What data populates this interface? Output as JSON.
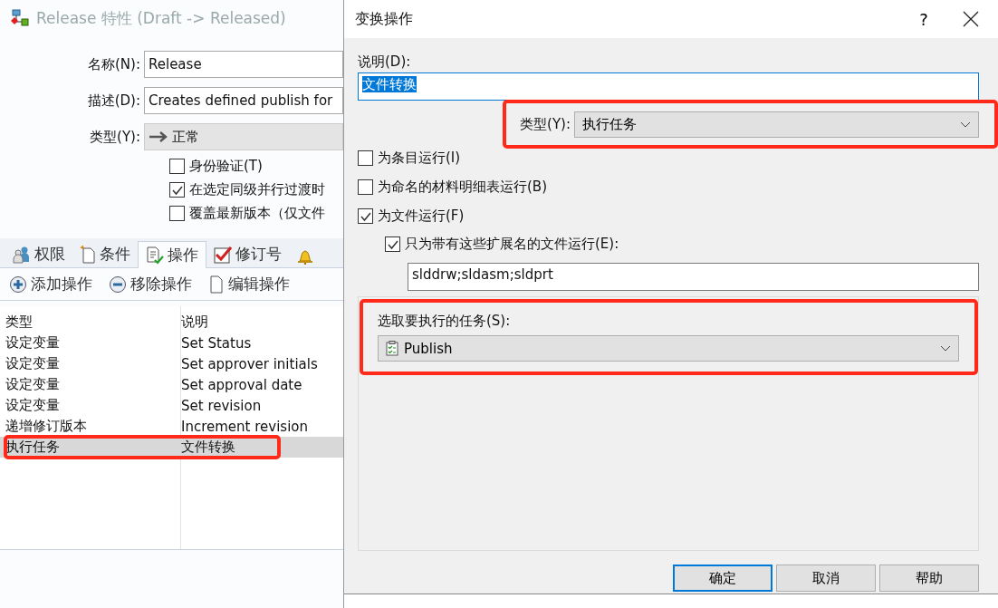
{
  "window": {
    "title": "Release 特性 (Draft -> Released)"
  },
  "form": {
    "name_label": "名称(N):",
    "name_value": "Release",
    "desc_label": "描述(D):",
    "desc_value": "Creates defined publish for",
    "type_label": "类型(Y):",
    "type_value": "正常",
    "checks": [
      {
        "label": "身份验证(T)",
        "checked": false
      },
      {
        "label": "在选定同级并行过渡时",
        "checked": true
      },
      {
        "label": "覆盖最新版本（仅文件",
        "checked": false
      }
    ]
  },
  "tabs": [
    {
      "label": "权限",
      "selected": false
    },
    {
      "label": "条件",
      "selected": false
    },
    {
      "label": "操作",
      "selected": true
    },
    {
      "label": "修订号",
      "selected": false
    },
    {
      "selected": false
    }
  ],
  "toolbar": [
    "添加操作",
    "移除操作",
    "编辑操作"
  ],
  "table": {
    "columns": [
      "类型",
      "说明"
    ],
    "rows": [
      {
        "cells": [
          "设定变量",
          "Set Status"
        ],
        "selected": false,
        "highlighted": false
      },
      {
        "cells": [
          "设定变量",
          "Set approver initials"
        ],
        "selected": false,
        "highlighted": false
      },
      {
        "cells": [
          "设定变量",
          "Set approval date"
        ],
        "selected": false,
        "highlighted": false
      },
      {
        "cells": [
          "设定变量",
          "Set revision"
        ],
        "selected": false,
        "highlighted": false
      },
      {
        "cells": [
          "递增修订版本",
          "Increment revision"
        ],
        "selected": false,
        "highlighted": false
      },
      {
        "cells": [
          "执行任务",
          "文件转换"
        ],
        "selected": true,
        "highlighted": true
      }
    ]
  },
  "dialog": {
    "title": "变换操作",
    "help": "?",
    "desc_label": "说明(D):",
    "desc_value": "文件转换",
    "type_label": "类型(Y):",
    "type_value": "执行任务",
    "type_highlighted": true,
    "checks": [
      {
        "label": "为条目运行(I)",
        "checked": false,
        "indented": false
      },
      {
        "label": "为命名的材料明细表运行(B)",
        "checked": false,
        "indented": false
      },
      {
        "label": "为文件运行(F)",
        "checked": true,
        "indented": false
      },
      {
        "label": "只为带有这些扩展名的文件运行(E):",
        "checked": true,
        "indented": true
      }
    ],
    "extensions": "slddrw;sldasm;sldprt",
    "task_label": "选取要执行的任务(S):",
    "task_value": "Publish",
    "task_highlighted": true,
    "buttons": [
      {
        "label": "确定",
        "default": true
      },
      {
        "label": "取消",
        "default": false
      },
      {
        "label": "帮助",
        "default": false
      }
    ]
  }
}
